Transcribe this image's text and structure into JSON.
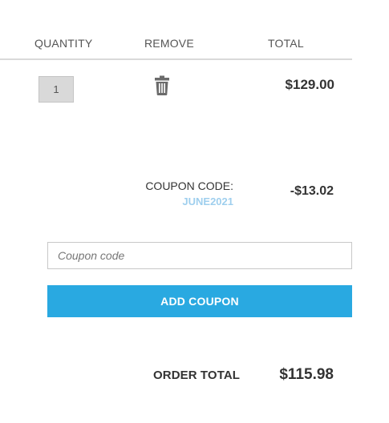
{
  "cart": {
    "headers": {
      "quantity": "QUANTITY",
      "remove": "REMOVE",
      "total": "TOTAL"
    },
    "item": {
      "quantity": "1",
      "line_total": "$129.00",
      "remove_icon": "trash-icon"
    }
  },
  "coupon": {
    "label": "COUPON CODE:",
    "code": "JUNE2021",
    "discount": "-$13.02",
    "input_placeholder": "Coupon code",
    "input_value": "",
    "button_label": "ADD COUPON"
  },
  "summary": {
    "order_total_label": "ORDER TOTAL",
    "order_total_value": "$115.98"
  },
  "colors": {
    "accent": "#29a9e1",
    "coupon_code": "#9fcfee",
    "text": "#333333"
  }
}
